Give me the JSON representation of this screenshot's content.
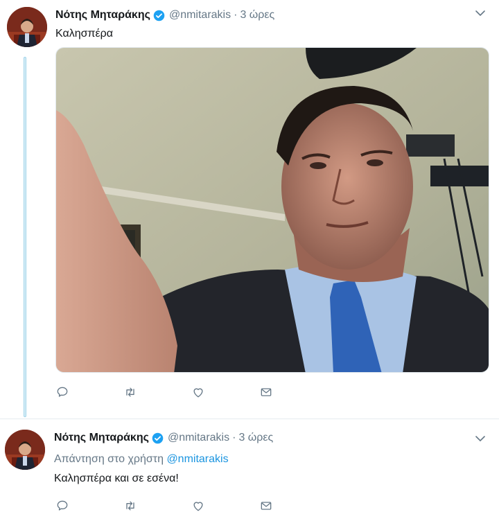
{
  "tweets": [
    {
      "author_name": "Νότης Μηταράκης",
      "author_handle": "@nmitarakis",
      "separator": "·",
      "time": "3 ώρες",
      "text": "Καλησπέρα",
      "has_media": true
    },
    {
      "author_name": "Νότης Μηταράκης",
      "author_handle": "@nmitarakis",
      "separator": "·",
      "time": "3 ώρες",
      "reply_prefix": "Απάντηση στο χρήστη",
      "reply_mention": "@nmitarakis",
      "text": "Καλησπέρα και σε εσένα!"
    }
  ],
  "actions": [
    "reply-icon",
    "retweet-icon",
    "like-icon",
    "direct-message-icon"
  ],
  "colors": {
    "secondary_text": "#657786",
    "link": "#1b95e0",
    "verified": "#1da1f2",
    "thread_line": "#9fd3e9"
  }
}
